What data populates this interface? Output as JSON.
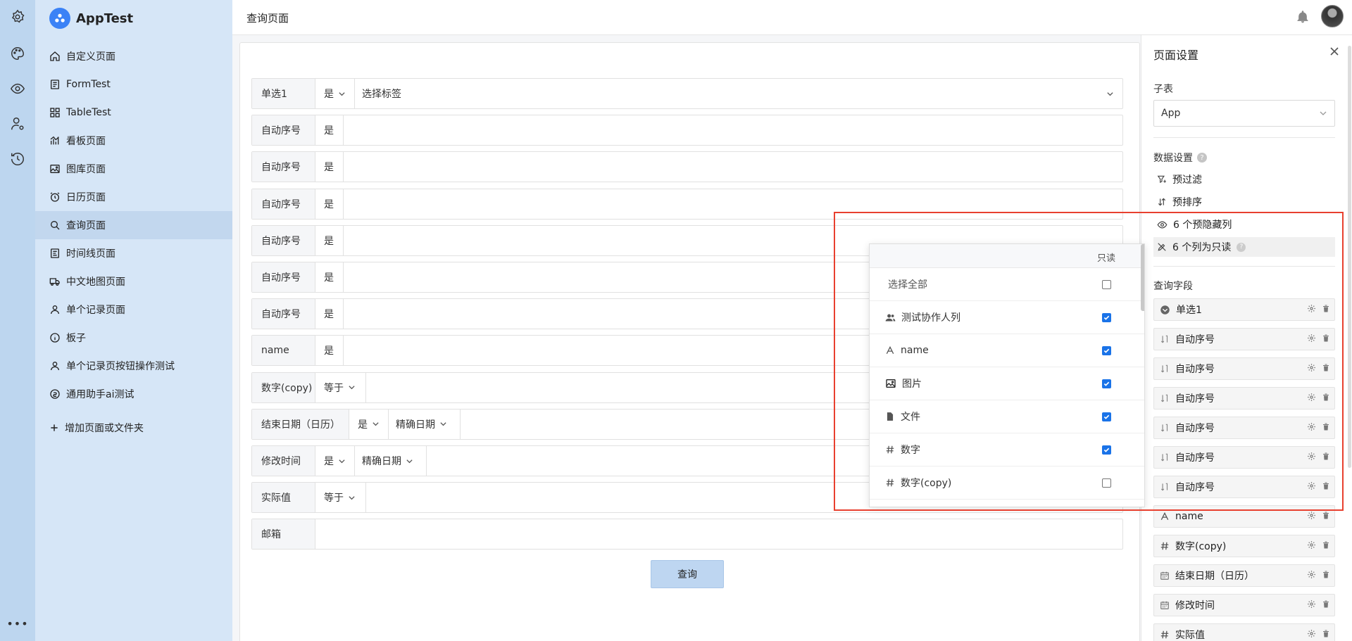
{
  "app": {
    "name": "AppTest"
  },
  "rail": {
    "more_label": "•••"
  },
  "nav": {
    "items": [
      {
        "label": "自定义页面",
        "icon": "home-icon"
      },
      {
        "label": "FormTest",
        "icon": "form-icon"
      },
      {
        "label": "TableTest",
        "icon": "table-icon"
      },
      {
        "label": "看板页面",
        "icon": "chart-icon"
      },
      {
        "label": "图库页面",
        "icon": "image-icon"
      },
      {
        "label": "日历页面",
        "icon": "alarm-icon"
      },
      {
        "label": "查询页面",
        "icon": "search-icon"
      },
      {
        "label": "时间线页面",
        "icon": "timeline-icon"
      },
      {
        "label": "中文地图页面",
        "icon": "truck-icon"
      },
      {
        "label": "单个记录页面",
        "icon": "user-icon"
      },
      {
        "label": "板子",
        "icon": "info-icon"
      },
      {
        "label": "单个记录页按钮操作测试",
        "icon": "user-icon"
      },
      {
        "label": "通用助手ai测试",
        "icon": "ai-icon"
      }
    ],
    "active_index": 6,
    "add_label": "增加页面或文件夹"
  },
  "header": {
    "title": "查询页面"
  },
  "query_form": {
    "rows": [
      {
        "label": "单选1",
        "op": "是",
        "op_dropdown": true,
        "extra": "",
        "input": "选择标签",
        "input_dropdown": true
      },
      {
        "label": "自动序号",
        "op": "是",
        "op_dropdown": false,
        "extra": "",
        "input": "",
        "input_dropdown": false
      },
      {
        "label": "自动序号",
        "op": "是",
        "op_dropdown": false,
        "extra": "",
        "input": "",
        "input_dropdown": false
      },
      {
        "label": "自动序号",
        "op": "是",
        "op_dropdown": false,
        "extra": "",
        "input": "",
        "input_dropdown": false
      },
      {
        "label": "自动序号",
        "op": "是",
        "op_dropdown": false,
        "extra": "",
        "input": "",
        "input_dropdown": false
      },
      {
        "label": "自动序号",
        "op": "是",
        "op_dropdown": false,
        "extra": "",
        "input": "",
        "input_dropdown": false
      },
      {
        "label": "自动序号",
        "op": "是",
        "op_dropdown": false,
        "extra": "",
        "input": "",
        "input_dropdown": false
      },
      {
        "label": "name",
        "op": "是",
        "op_dropdown": false,
        "extra": "",
        "input": "",
        "input_dropdown": false
      },
      {
        "label": "数字(copy)",
        "op": "等于",
        "op_dropdown": true,
        "extra": "",
        "input": "",
        "input_dropdown": false
      },
      {
        "label": "结束日期（日历）",
        "op": "是",
        "op_dropdown": true,
        "extra": "精确日期",
        "input": "",
        "input_dropdown": false
      },
      {
        "label": "修改时间",
        "op": "是",
        "op_dropdown": true,
        "extra": "精确日期",
        "input": "",
        "input_dropdown": false
      },
      {
        "label": "实际值",
        "op": "等于",
        "op_dropdown": true,
        "extra": "",
        "input": "",
        "input_dropdown": false
      },
      {
        "label": "邮箱",
        "op": "",
        "op_dropdown": false,
        "extra": "",
        "input": "",
        "input_dropdown": false
      }
    ],
    "query_button": "查询"
  },
  "settings_panel": {
    "title": "页面设置",
    "subtable_label": "子表",
    "subtable_value": "App",
    "data_settings_label": "数据设置",
    "links": [
      {
        "label": "预过滤",
        "icon": "filter-icon"
      },
      {
        "label": "预排序",
        "icon": "sort-icon"
      },
      {
        "label": "6 个预隐藏列",
        "icon": "eye-icon"
      },
      {
        "label": "6 个列为只读",
        "icon": "pen-off-icon"
      }
    ],
    "query_fields_label": "查询字段",
    "query_fields": [
      {
        "label": "单选1",
        "icon": "select-icon"
      },
      {
        "label": "自动序号",
        "icon": "autonumber-icon"
      },
      {
        "label": "自动序号",
        "icon": "autonumber-icon"
      },
      {
        "label": "自动序号",
        "icon": "autonumber-icon"
      },
      {
        "label": "自动序号",
        "icon": "autonumber-icon"
      },
      {
        "label": "自动序号",
        "icon": "autonumber-icon"
      },
      {
        "label": "自动序号",
        "icon": "autonumber-icon"
      },
      {
        "label": "name",
        "icon": "text-icon"
      },
      {
        "label": "数字(copy)",
        "icon": "hash-icon"
      },
      {
        "label": "结束日期（日历）",
        "icon": "calendar-icon"
      },
      {
        "label": "修改时间",
        "icon": "calendar-icon"
      },
      {
        "label": "实际值",
        "icon": "hash-icon"
      }
    ]
  },
  "readonly_dropdown": {
    "column_header": "只读",
    "select_all_label": "选择全部",
    "select_all_checked": false,
    "items": [
      {
        "label": "测试协作人列",
        "icon": "users-icon",
        "checked": true
      },
      {
        "label": "name",
        "icon": "text-icon",
        "checked": true
      },
      {
        "label": "图片",
        "icon": "image-icon",
        "checked": true
      },
      {
        "label": "文件",
        "icon": "file-icon",
        "checked": true
      },
      {
        "label": "数字",
        "icon": "hash-icon",
        "checked": true
      },
      {
        "label": "数字(copy)",
        "icon": "hash-icon",
        "checked": false
      }
    ]
  },
  "colors": {
    "accent": "#1a73e8",
    "highlight_border": "#e8402f",
    "sidebar_bg": "#d6e6f7",
    "rail_bg": "#bdd6ef"
  }
}
